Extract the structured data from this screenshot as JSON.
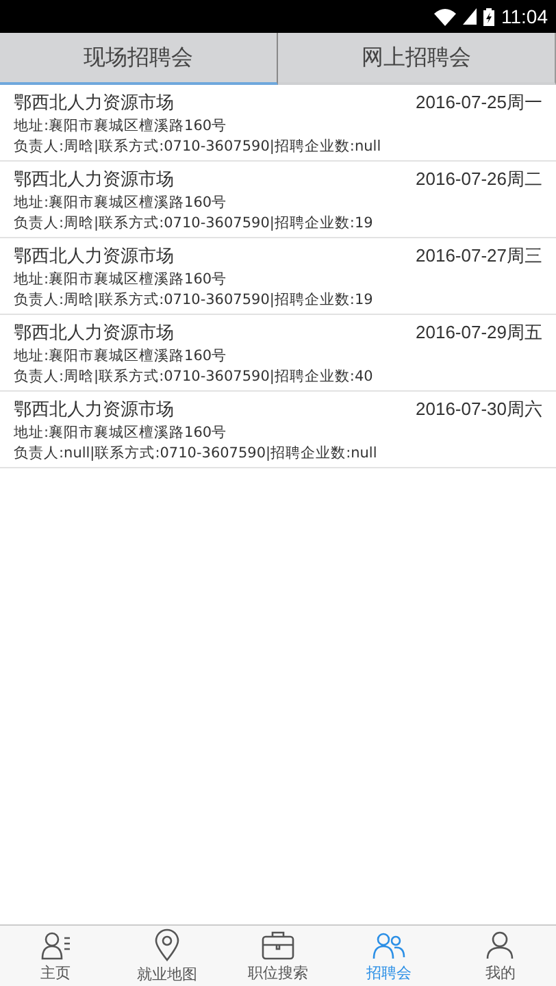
{
  "status_bar": {
    "time": "11:04"
  },
  "tabs": [
    {
      "label": "现场招聘会",
      "selected": true
    },
    {
      "label": "网上招聘会",
      "selected": false
    }
  ],
  "fairs": [
    {
      "name": "鄂西北人力资源市场",
      "date": "2016-07-25周一",
      "address": "地址:襄阳市襄城区檀溪路160号",
      "contact": "负责人:周晗|联系方式:0710-3607590|招聘企业数:null"
    },
    {
      "name": "鄂西北人力资源市场",
      "date": "2016-07-26周二",
      "address": "地址:襄阳市襄城区檀溪路160号",
      "contact": "负责人:周晗|联系方式:0710-3607590|招聘企业数:19"
    },
    {
      "name": "鄂西北人力资源市场",
      "date": "2016-07-27周三",
      "address": "地址:襄阳市襄城区檀溪路160号",
      "contact": "负责人:周晗|联系方式:0710-3607590|招聘企业数:19"
    },
    {
      "name": "鄂西北人力资源市场",
      "date": "2016-07-29周五",
      "address": "地址:襄阳市襄城区檀溪路160号",
      "contact": "负责人:周晗|联系方式:0710-3607590|招聘企业数:40"
    },
    {
      "name": "鄂西北人力资源市场",
      "date": "2016-07-30周六",
      "address": "地址:襄阳市襄城区檀溪路160号",
      "contact": "负责人:null|联系方式:0710-3607590|招聘企业数:null"
    }
  ],
  "bottom_nav": [
    {
      "kind": "person",
      "label": "主页",
      "selected": false
    },
    {
      "kind": "pin",
      "label": "就业地图",
      "selected": false
    },
    {
      "kind": "briefcase",
      "label": "职位搜索",
      "selected": false
    },
    {
      "kind": "fair",
      "label": "招聘会",
      "selected": true
    },
    {
      "kind": "me",
      "label": "我的",
      "selected": false
    }
  ]
}
